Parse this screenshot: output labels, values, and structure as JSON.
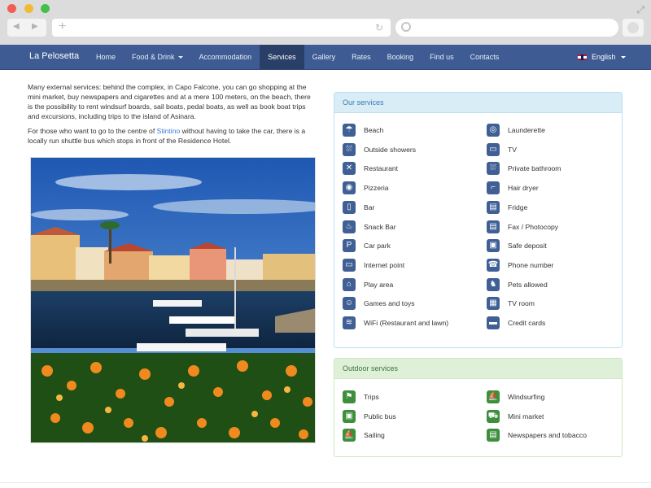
{
  "site": {
    "brand": "La Pelosetta",
    "nav": [
      {
        "label": "Home"
      },
      {
        "label": "Food & Drink",
        "dropdown": true
      },
      {
        "label": "Accommodation"
      },
      {
        "label": "Services",
        "active": true
      },
      {
        "label": "Gallery"
      },
      {
        "label": "Rates"
      },
      {
        "label": "Booking"
      },
      {
        "label": "Find us"
      },
      {
        "label": "Contacts"
      }
    ],
    "language": "English"
  },
  "content": {
    "para1": "Many external services: behind the complex, in Capo Falcone, you can go shopping at the mini market, buy newspapers and cigarettes and at a mere 100 meters, on the beach, there is the possibility to rent windsurf boards, sail boats, pedal boats, as well as book boat trips and excursions, including trips to the island of Asinara.",
    "para2_before": "For those who want to go to the centre of ",
    "para2_link": "Stintino",
    "para2_after": " without having to take the car, there is a locally run shuttle bus which stops in front of the Residence Hotel."
  },
  "our_services": {
    "title": "Our services",
    "left": [
      {
        "label": "Beach",
        "icon": "beach-icon"
      },
      {
        "label": "Outside showers",
        "icon": "shower-icon"
      },
      {
        "label": "Restaurant",
        "icon": "restaurant-icon"
      },
      {
        "label": "Pizzeria",
        "icon": "pizza-icon"
      },
      {
        "label": "Bar",
        "icon": "bar-icon"
      },
      {
        "label": "Snack Bar",
        "icon": "snack-icon"
      },
      {
        "label": "Car park",
        "icon": "parking-icon"
      },
      {
        "label": "Internet point",
        "icon": "computer-icon"
      },
      {
        "label": "Play area",
        "icon": "playground-icon"
      },
      {
        "label": "Games and toys",
        "icon": "toys-icon"
      },
      {
        "label": "WiFi (Restaurant and lawn)",
        "icon": "wifi-icon"
      }
    ],
    "right": [
      {
        "label": "Launderette",
        "icon": "washing-machine-icon"
      },
      {
        "label": "TV",
        "icon": "tv-icon"
      },
      {
        "label": "Private bathroom",
        "icon": "bathroom-icon"
      },
      {
        "label": "Hair dryer",
        "icon": "hair-dryer-icon"
      },
      {
        "label": "Fridge",
        "icon": "fridge-icon"
      },
      {
        "label": "Fax / Photocopy",
        "icon": "fax-icon"
      },
      {
        "label": "Safe deposit",
        "icon": "safe-icon"
      },
      {
        "label": "Phone number",
        "icon": "phone-icon"
      },
      {
        "label": "Pets allowed",
        "icon": "pets-icon"
      },
      {
        "label": "TV room",
        "icon": "tv-room-icon"
      },
      {
        "label": "Credit cards",
        "icon": "credit-card-icon"
      }
    ]
  },
  "outdoor_services": {
    "title": "Outdoor services",
    "left": [
      {
        "label": "Trips",
        "icon": "hiking-icon"
      },
      {
        "label": "Public bus",
        "icon": "bus-icon"
      },
      {
        "label": "Sailing",
        "icon": "sailboat-icon"
      }
    ],
    "right": [
      {
        "label": "Windsurfing",
        "icon": "windsurf-icon"
      },
      {
        "label": "Mini market",
        "icon": "shopping-cart-icon"
      },
      {
        "label": "Newspapers and tobacco",
        "icon": "newspaper-icon"
      }
    ]
  },
  "colors": {
    "navbar": "#3e5c93",
    "active_tab": "#2a3f68",
    "info_panel": "#d9edf7",
    "success_panel": "#dff0d8",
    "icon_blue": "#3f5f95",
    "icon_green": "#3d8f3d"
  }
}
